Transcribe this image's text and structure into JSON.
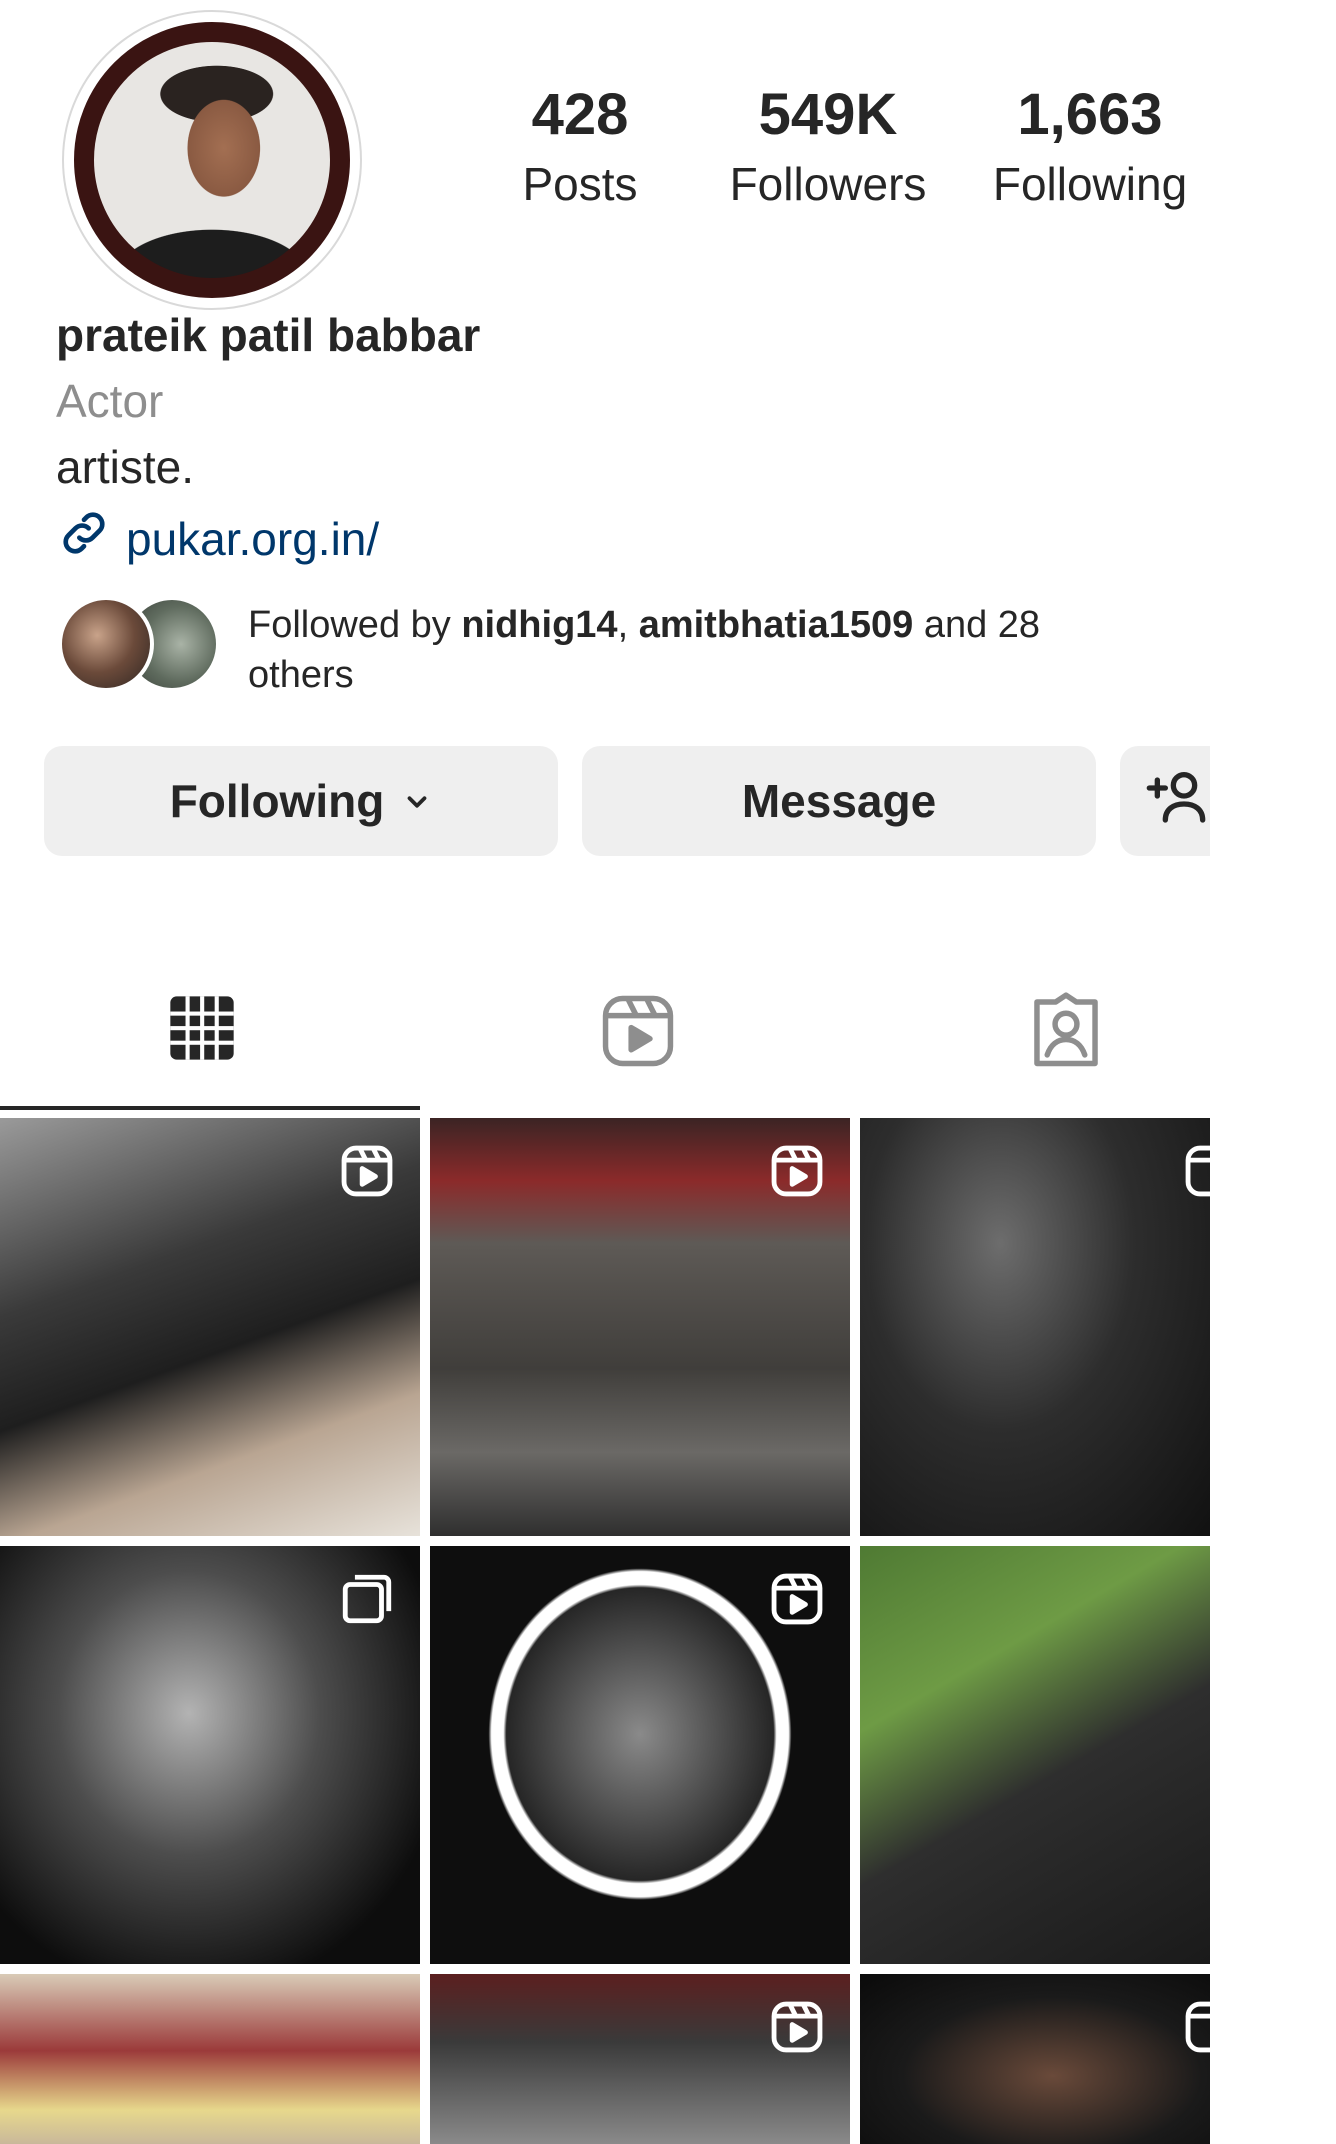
{
  "profile": {
    "name": "prateik patil babbar",
    "category": "Actor",
    "bio": "artiste.",
    "link": "pukar.org.in/"
  },
  "stats": {
    "posts_count": "428",
    "posts_label": "Posts",
    "followers_count": "549K",
    "followers_label": "Followers",
    "following_count": "1,663",
    "following_label": "Following"
  },
  "followed_by": {
    "prefix": "Followed by ",
    "user1": "nidhig14",
    "separator": ", ",
    "user2": "amitbhatia1509",
    "suffix": " and 28 others"
  },
  "actions": {
    "following_label": "Following",
    "message_label": "Message"
  },
  "tabs": [
    {
      "icon": "grid-icon",
      "active": true
    },
    {
      "icon": "reels-icon",
      "active": false
    },
    {
      "icon": "tagged-icon",
      "active": false
    }
  ],
  "grid": {
    "posts": [
      {
        "icon": "reel-badge-icon"
      },
      {
        "icon": "reel-badge-icon"
      },
      {
        "icon": "reel-badge-icon"
      },
      {
        "icon": "multi-photo-icon"
      },
      {
        "icon": "reel-badge-icon"
      },
      {
        "icon": "none"
      },
      {
        "icon": "none"
      },
      {
        "icon": "reel-badge-icon"
      },
      {
        "icon": "reel-badge-icon"
      }
    ]
  },
  "colors": {
    "link": "#00376b",
    "secondary_text": "#8e8e8e",
    "button_bg": "#efefef",
    "avatar_ring": "#3a1412"
  }
}
